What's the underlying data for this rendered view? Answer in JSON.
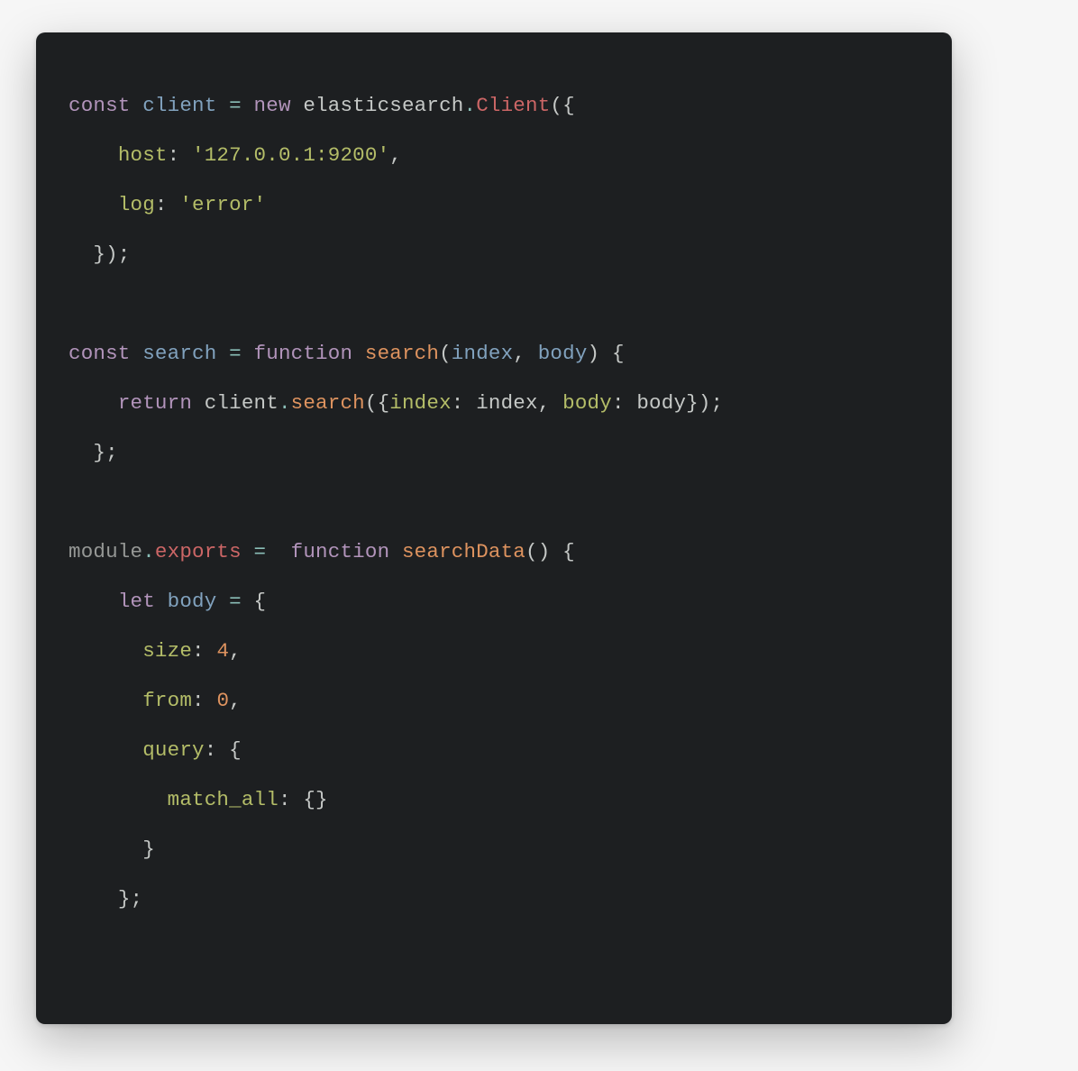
{
  "code": {
    "line1": {
      "kw_const": "const",
      "ident": "client",
      "op_eq": "=",
      "kw_new": "new",
      "ns": "elasticsearch",
      "dot": ".",
      "cls": "Client",
      "open": "({"
    },
    "line2": {
      "indent": "    ",
      "key": "host",
      "colon": ":",
      "str": "'127.0.0.1:9200'",
      "comma": ","
    },
    "line3": {
      "indent": "    ",
      "key": "log",
      "colon": ":",
      "str": "'error'"
    },
    "line4": {
      "indent": "  ",
      "close": "});"
    },
    "line6": {
      "kw_const": "const",
      "ident": "search",
      "op_eq": "=",
      "kw_fn": "function",
      "fnname": "search",
      "open_paren": "(",
      "param1": "index",
      "comma": ",",
      "param2": "body",
      "close_paren": ")",
      "brace": "{"
    },
    "line7": {
      "indent": "    ",
      "kw_return": "return",
      "obj": "client",
      "dot": ".",
      "method": "search",
      "open": "({",
      "key1": "index",
      "colon1": ":",
      "val1": "index",
      "comma1": ",",
      "key2": "body",
      "colon2": ":",
      "val2": "body",
      "close": "});"
    },
    "line8": {
      "indent": "  ",
      "close": "};"
    },
    "line10": {
      "mod": "module",
      "dot": ".",
      "exp": "exports",
      "op_eq": "=",
      "kw_fn": "function",
      "fnname": "searchData",
      "parens": "()",
      "brace": "{"
    },
    "line11": {
      "indent": "    ",
      "kw_let": "let",
      "ident": "body",
      "op_eq": "=",
      "brace": "{"
    },
    "line12": {
      "indent": "      ",
      "key": "size",
      "colon": ":",
      "num": "4",
      "comma": ","
    },
    "line13": {
      "indent": "      ",
      "key": "from",
      "colon": ":",
      "num": "0",
      "comma": ","
    },
    "line14": {
      "indent": "      ",
      "key": "query",
      "colon": ":",
      "brace": "{"
    },
    "line15": {
      "indent": "        ",
      "key": "match_all",
      "colon": ":",
      "braces": "{}"
    },
    "line16": {
      "indent": "      ",
      "brace": "}"
    },
    "line17": {
      "indent": "    ",
      "close": "};"
    }
  }
}
